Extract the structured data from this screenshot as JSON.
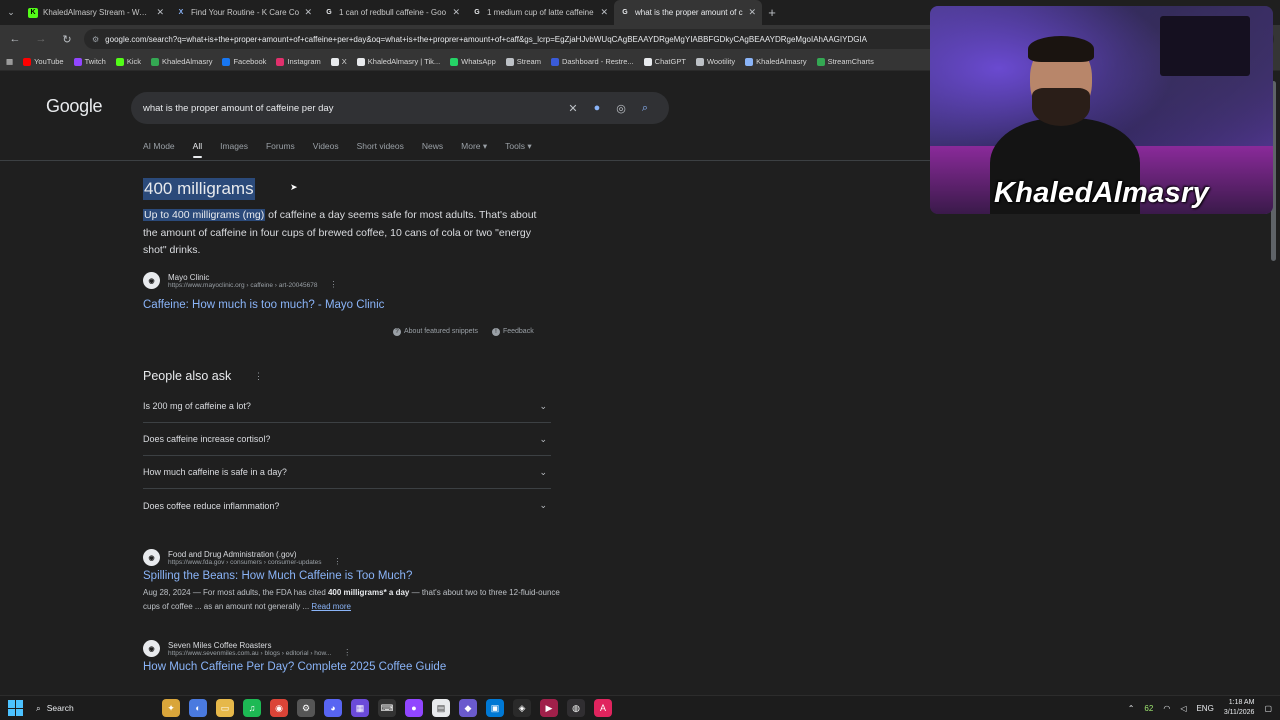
{
  "tabs": [
    {
      "title": "KhaledAlmasry Stream - Watch",
      "icon": "kick-icon",
      "color": "#53fc18",
      "glyph": "K",
      "active": false
    },
    {
      "title": "Find Your Routine - K Care Co",
      "icon": "x-icon",
      "color": "#8ab4f8",
      "glyph": "X",
      "active": false
    },
    {
      "title": "1 can of redbull caffeine - Goo",
      "icon": "google-icon",
      "color": "#e8eaed",
      "glyph": "G",
      "active": false
    },
    {
      "title": "1 medium cup of latte caffeine",
      "icon": "google-icon",
      "color": "#e8eaed",
      "glyph": "G",
      "active": false
    },
    {
      "title": "what is the proper amount of c",
      "icon": "google-icon",
      "color": "#e8eaed",
      "glyph": "G",
      "active": true
    }
  ],
  "omnibox": {
    "url": "google.com/search?q=what+is+the+proper+amount+of+caffeine+per+day&oq=what+is+the+proprer+amount+of+caff&gs_lcrp=EgZjaHJvbWUqCAgBEAAYDRgeMgYIABBFGDkyCAgBEAAYDRgeMgoIAhAAGIYDGIA"
  },
  "bookmarks": [
    {
      "label": "YouTube",
      "color": "#ff0000"
    },
    {
      "label": "Twitch",
      "color": "#9146ff"
    },
    {
      "label": "Kick",
      "color": "#53fc18"
    },
    {
      "label": "KhaledAlmasry",
      "color": "#34a853"
    },
    {
      "label": "Facebook",
      "color": "#1877f2"
    },
    {
      "label": "Instagram",
      "color": "#e1306c"
    },
    {
      "label": "X",
      "color": "#e8eaed"
    },
    {
      "label": "KhaledAlmasry | Tik...",
      "color": "#e8eaed"
    },
    {
      "label": "WhatsApp",
      "color": "#25d366"
    },
    {
      "label": "Stream",
      "color": "#bdc1c6"
    },
    {
      "label": "Dashboard - Restre...",
      "color": "#3a5bd9"
    },
    {
      "label": "ChatGPT",
      "color": "#e8eaed"
    },
    {
      "label": "Wootility",
      "color": "#bdc1c6"
    },
    {
      "label": "KhaledAlmasry",
      "color": "#8ab4f8"
    },
    {
      "label": "StreamCharts",
      "color": "#34a853"
    }
  ],
  "google": {
    "logo": "Google",
    "query": "what is the proper amount of caffeine per day",
    "filters": [
      "AI Mode",
      "All",
      "Images",
      "Forums",
      "Videos",
      "Short videos",
      "News",
      "More ▾",
      "Tools ▾"
    ],
    "selected_filter": "All"
  },
  "snippet": {
    "heading": "400 milligrams",
    "highlight": "Up to 400 milligrams (mg)",
    "text_after": " of caffeine a day seems safe for most adults. That's about the amount of caffeine in four cups of brewed coffee, 10 cans of cola or two \"energy shot\" drinks.",
    "source_name": "Mayo Clinic",
    "source_url": "https://www.mayoclinic.org › caffeine › art-20045678",
    "link_title": "Caffeine: How much is too much? - Mayo Clinic",
    "about": "About featured snippets",
    "feedback": "Feedback"
  },
  "paa": {
    "title": "People also ask",
    "questions": [
      "Is 200 mg of caffeine a lot?",
      "Does caffeine increase cortisol?",
      "How much caffeine is safe in a day?",
      "Does coffee reduce inflammation?"
    ]
  },
  "results": [
    {
      "source_name": "Food and Drug Administration (.gov)",
      "source_url": "https://www.fda.gov › consumers › consumer-updates",
      "title": "Spilling the Beans: How Much Caffeine is Too Much?",
      "date": "Aug 28, 2024 — For most adults, the FDA has cited ",
      "bold": "400 milligrams* a day",
      "desc": " — that's about two to three 12-fluid-ounce cups of coffee ... as an amount not generally ...",
      "more": "Read more"
    },
    {
      "source_name": "Seven Miles Coffee Roasters",
      "source_url": "https://www.sevenmiles.com.au › blogs › editorial › how...",
      "title": "How Much Caffeine Per Day? Complete 2025 Coffee Guide"
    }
  ],
  "webcam": {
    "name": "KhaledAlmasry"
  },
  "taskbar": {
    "search": "Search",
    "battery_num": "62",
    "lang": "ENG",
    "time": "1:18 AM",
    "date": "3/11/2026"
  }
}
